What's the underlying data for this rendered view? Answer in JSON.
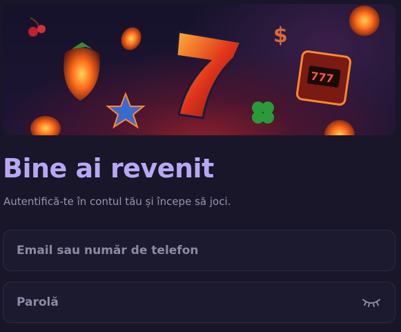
{
  "login": {
    "title": "Bine ai revenit",
    "subtitle": "Autentifică-te în contul tău și începe să joci.",
    "email_placeholder": "Email sau număr de telefon",
    "password_placeholder": "Parolă"
  },
  "icons": {
    "password_toggle": "eye-closed-icon"
  },
  "colors": {
    "background": "#181628",
    "title": "#b9a7f5",
    "subtitle": "#9a93b3",
    "field_border": "#2e2a45",
    "field_text": "#8f89a6"
  }
}
